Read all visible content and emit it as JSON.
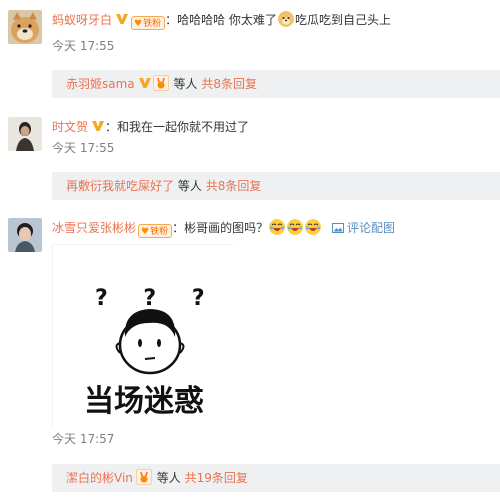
{
  "comments": [
    {
      "username": "蚂蚁呀牙白",
      "fan_badge": "铁粉",
      "text_before_emoji": "：哈哈哈哈 你太难了",
      "text_after_emoji": "吃瓜吃到自己头上",
      "time": "今天 17:55",
      "reply_user": "赤羽姬sama",
      "reply_mid": "等人",
      "reply_count": "共8条回复"
    },
    {
      "username": "时文贺",
      "text": "：和我在一起你就不用过了",
      "time": "今天 17:55",
      "reply_text": "再敷衍我就吃屎好了",
      "reply_mid": "等人",
      "reply_count": "共8条回复"
    },
    {
      "username": "冰雪只爱张彬彬",
      "fan_badge": "铁粉",
      "text": "：彬哥画的图吗？",
      "image_comment": "评论配图",
      "sticker_text": "当场迷惑",
      "sticker_marks": "? ? ?",
      "time": "今天 17:57",
      "reply_user": "潔白的彬Vin",
      "reply_mid": "等人",
      "reply_count": "共19条回复"
    }
  ],
  "colors": {
    "link": "#eb7350",
    "time": "#808080",
    "reply_bg": "#eef0f2",
    "vip_gold": "#f5a623",
    "fan_orange": "#ff6a00"
  },
  "icons": [
    "v-badge-icon",
    "fan-badge-icon",
    "doge-emoji-icon",
    "laugh-cry-emoji-icon",
    "picture-icon"
  ]
}
